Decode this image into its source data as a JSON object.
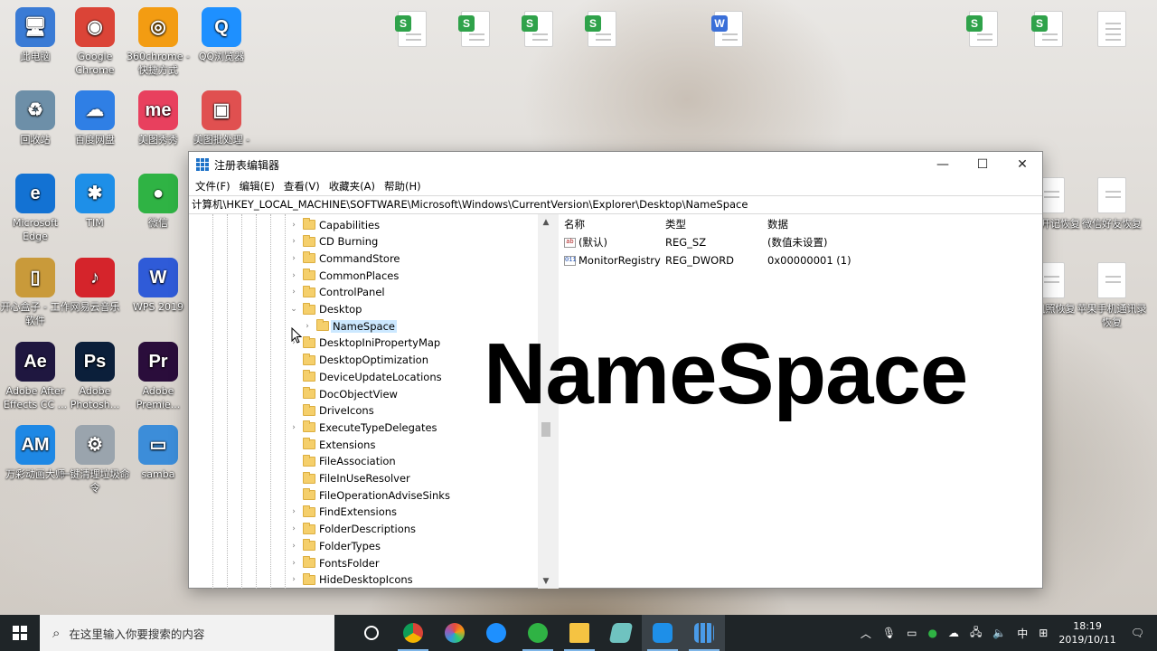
{
  "desktop": {
    "icons": [
      {
        "label": "此电脑",
        "glyph": "🖥",
        "color": "#3a7bd5"
      },
      {
        "label": "Google Chrome",
        "glyph": "◉",
        "color": "#db4437"
      },
      {
        "label": "360chrome - 快捷方式",
        "glyph": "◎",
        "color": "#f39c12"
      },
      {
        "label": "QQ浏览器",
        "glyph": "Q",
        "color": "#1e90ff"
      },
      {
        "label": "回收站",
        "glyph": "♻",
        "color": "#6d8fa8"
      },
      {
        "label": "百度网盘",
        "glyph": "☁",
        "color": "#2f7fe5"
      },
      {
        "label": "美图秀秀",
        "glyph": "me",
        "color": "#e8405e"
      },
      {
        "label": "美图批处理 -",
        "glyph": "▣",
        "color": "#e05050"
      },
      {
        "label": "Microsoft Edge",
        "glyph": "e",
        "color": "#1372d3"
      },
      {
        "label": "TIM",
        "glyph": "✱",
        "color": "#1e8fe8"
      },
      {
        "label": "微信",
        "glyph": "●",
        "color": "#2fb344"
      },
      {
        "label": "开心盒子 - 工作软件",
        "glyph": "▯",
        "color": "#c99a3a"
      },
      {
        "label": "网易云音乐",
        "glyph": "♪",
        "color": "#d5242b"
      },
      {
        "label": "WPS 2019",
        "glyph": "W",
        "color": "#2f5bd8"
      },
      {
        "label": "Adobe After Effects CC ...",
        "glyph": "Ae",
        "color": "#1f1740"
      },
      {
        "label": "Adobe Photosh...",
        "glyph": "Ps",
        "color": "#0b1f3a"
      },
      {
        "label": "Adobe Premie...",
        "glyph": "Pr",
        "color": "#2a0d3b"
      },
      {
        "label": "万彩动画大师",
        "glyph": "AM",
        "color": "#1e88e5"
      },
      {
        "label": "一键清理垃圾命令",
        "glyph": "⚙",
        "color": "#9aa4ad"
      },
      {
        "label": "samba",
        "glyph": "▭",
        "color": "#3c8dd9"
      }
    ],
    "right_files": [
      {
        "label": "数据开记恢复"
      },
      {
        "label": "微信好友恢复"
      },
      {
        "label": "手机照恢复"
      },
      {
        "label": "苹果手机通讯录恢复"
      }
    ]
  },
  "window": {
    "title": "注册表编辑器",
    "controls": {
      "minimize": "—",
      "maximize": "☐",
      "close": "✕"
    },
    "menu": [
      "文件(F)",
      "编辑(E)",
      "查看(V)",
      "收藏夹(A)",
      "帮助(H)"
    ],
    "address": "计算机\\HKEY_LOCAL_MACHINE\\SOFTWARE\\Microsoft\\Windows\\CurrentVersion\\Explorer\\Desktop\\NameSpace",
    "tree": [
      {
        "label": "Capabilities",
        "expander": "›"
      },
      {
        "label": "CD Burning",
        "expander": "›"
      },
      {
        "label": "CommandStore",
        "expander": "›"
      },
      {
        "label": "CommonPlaces",
        "expander": "›"
      },
      {
        "label": "ControlPanel",
        "expander": "›"
      },
      {
        "label": "Desktop",
        "expander": "⌄"
      },
      {
        "label": "NameSpace",
        "expander": "›",
        "child": true,
        "selected": true
      },
      {
        "label": "DesktopIniPropertyMap",
        "expander": "›"
      },
      {
        "label": "DesktopOptimization",
        "expander": ""
      },
      {
        "label": "DeviceUpdateLocations",
        "expander": ""
      },
      {
        "label": "DocObjectView",
        "expander": ""
      },
      {
        "label": "DriveIcons",
        "expander": ""
      },
      {
        "label": "ExecuteTypeDelegates",
        "expander": "›"
      },
      {
        "label": "Extensions",
        "expander": ""
      },
      {
        "label": "FileAssociation",
        "expander": ""
      },
      {
        "label": "FileInUseResolver",
        "expander": ""
      },
      {
        "label": "FileOperationAdviseSinks",
        "expander": ""
      },
      {
        "label": "FindExtensions",
        "expander": "›"
      },
      {
        "label": "FolderDescriptions",
        "expander": "›"
      },
      {
        "label": "FolderTypes",
        "expander": "›"
      },
      {
        "label": "FontsFolder",
        "expander": "›"
      },
      {
        "label": "HideDesktopIcons",
        "expander": "›"
      }
    ],
    "values": {
      "headers": {
        "name": "名称",
        "type": "类型",
        "data": "数据"
      },
      "rows": [
        {
          "icon": "ab",
          "name": "(默认)",
          "type": "REG_SZ",
          "data": "(数值未设置)"
        },
        {
          "icon": "011",
          "name": "MonitorRegistry",
          "type": "REG_DWORD",
          "data": "0x00000001 (1)"
        }
      ]
    }
  },
  "overlay_text": "NameSpace",
  "taskbar": {
    "search_placeholder": "在这里输入你要搜索的内容",
    "apps": [
      {
        "name": "cortana",
        "color": "#1f2528"
      },
      {
        "name": "chrome",
        "color": "#db4437"
      },
      {
        "name": "360chrome",
        "color": "#f39c12"
      },
      {
        "name": "qq-browser",
        "color": "#1e90ff"
      },
      {
        "name": "wechat",
        "color": "#2fb344"
      },
      {
        "name": "file-explorer",
        "color": "#f5c342"
      },
      {
        "name": "notepad",
        "color": "#6fc3c0"
      },
      {
        "name": "tim",
        "color": "#1e8fe8"
      },
      {
        "name": "regedit",
        "color": "#1e72c8"
      }
    ],
    "tray": {
      "ime": "中",
      "time": "18:19",
      "date": "2019/10/11"
    }
  }
}
